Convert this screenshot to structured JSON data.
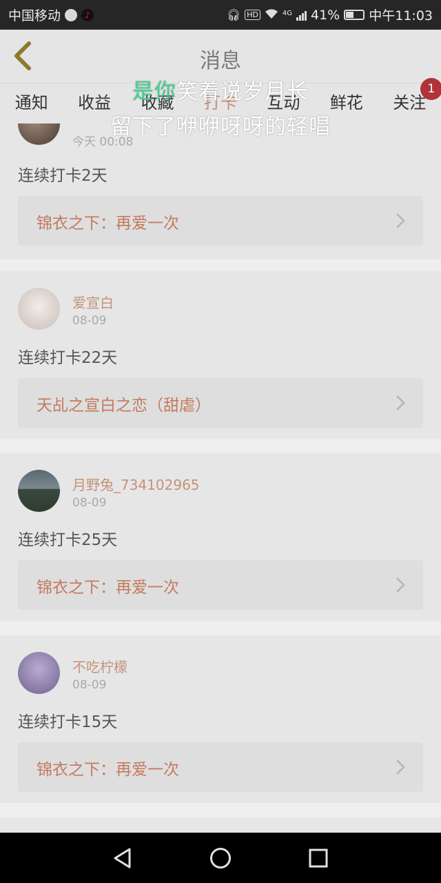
{
  "status_bar": {
    "carrier": "中国移动",
    "battery": "41%",
    "network": "4G",
    "time": "中午11:03",
    "icons": [
      "globe-icon",
      "tiktok-icon",
      "headset-icon",
      "hd-icon",
      "wifi-icon",
      "signal-icon",
      "battery-icon"
    ]
  },
  "header": {
    "title": "消息",
    "back_icon": "chevron-left-icon"
  },
  "tabs": [
    {
      "label": "通知"
    },
    {
      "label": "收益"
    },
    {
      "label": "收藏"
    },
    {
      "label": "打卡"
    },
    {
      "label": "互动"
    },
    {
      "label": "鲜花"
    },
    {
      "label": "关注",
      "badge": "1"
    }
  ],
  "active_tab": "打卡",
  "overlay_lyrics": {
    "line1_highlight": "是你",
    "line1_rest": "笑着说岁月长",
    "line2": "留下了咿咿呀呀的轻唱"
  },
  "posts": [
    {
      "user": "",
      "date": "今天 00:08",
      "streak": "连续打卡2天",
      "book": "锦衣之下：再爱一次"
    },
    {
      "user": "爱宣白",
      "date": "08-09",
      "streak": "连续打卡22天",
      "book": "天乩之宣白之恋（甜虐）"
    },
    {
      "user": "月野兔_734102965",
      "date": "08-09",
      "streak": "连续打卡25天",
      "book": "锦衣之下：再爱一次"
    },
    {
      "user": "不吃柠檬",
      "date": "08-09",
      "streak": "连续打卡15天",
      "book": "锦衣之下：再爱一次"
    }
  ],
  "colors": {
    "accent": "#c47a5e",
    "username": "#c49378",
    "badge": "#b0333a",
    "lyric_highlight": "#3fd18f"
  },
  "nav_bar": {
    "icons": [
      "back-triangle-icon",
      "home-circle-icon",
      "recents-square-icon"
    ]
  }
}
